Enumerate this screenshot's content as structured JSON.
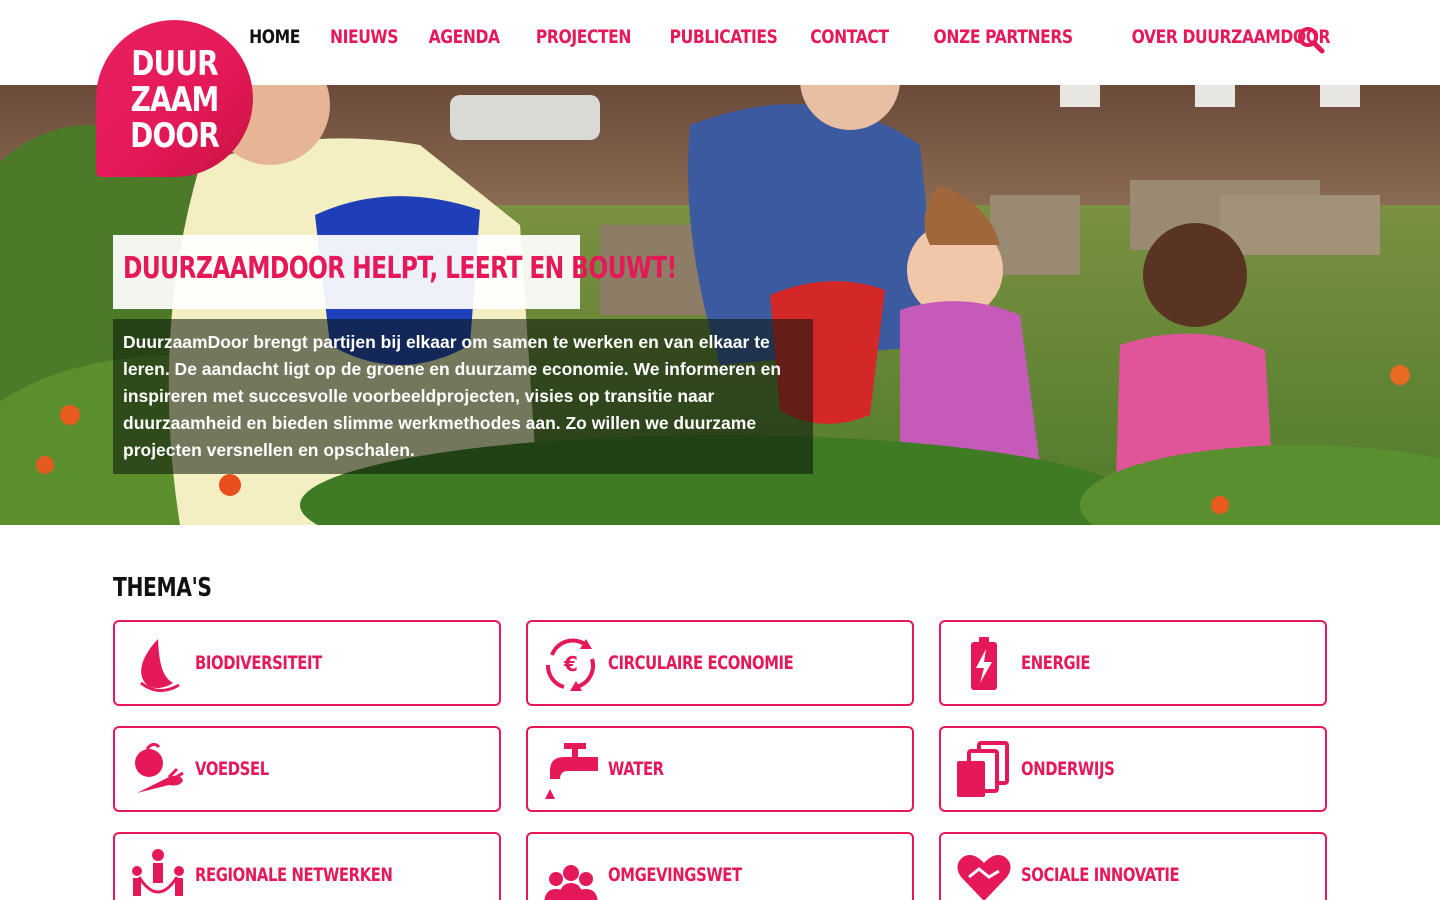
{
  "logo": {
    "text_lines": [
      "DUUR",
      "ZAAM",
      "DOOR"
    ]
  },
  "nav": {
    "items": [
      "Home",
      "Nieuws",
      "Agenda",
      "Projecten",
      "Publicaties",
      "Contact",
      "Onze partners",
      "Over DuurzaamDoor"
    ],
    "active": "Home",
    "search_icon": "search-icon"
  },
  "hero": {
    "title": "DuurzaamDoor helpt, leert en bouwt!",
    "text": "DuurzaamDoor brengt partijen bij elkaar om samen te werken en van elkaar te leren. De aandacht ligt op de groene en duurzame economie. We informeren en inspireren met succesvolle voorbeeldprojecten, visies op transitie naar duurzaamheid en bieden slimme werkmethodes aan. Zo willen we duurzame projecten versnellen en opschalen."
  },
  "themes": {
    "title": "Thema's",
    "items": [
      {
        "label": "Biodiversiteit",
        "icon": "leaf-icon"
      },
      {
        "label": "Circulaire economie",
        "icon": "euro-cycle-icon"
      },
      {
        "label": "Energie",
        "icon": "battery-icon"
      },
      {
        "label": "Voedsel",
        "icon": "vegetables-icon"
      },
      {
        "label": "Water",
        "icon": "water-tap-icon"
      },
      {
        "label": "Onderwijs",
        "icon": "books-icon"
      },
      {
        "label": "Regionale netwerken",
        "icon": "network-people-icon"
      },
      {
        "label": "Omgevingswet",
        "icon": "group-people-icon"
      },
      {
        "label": "Sociale innovatie",
        "icon": "heart-handshake-icon"
      }
    ]
  },
  "colors": {
    "accent": "#e5195a",
    "text": "#111111"
  }
}
